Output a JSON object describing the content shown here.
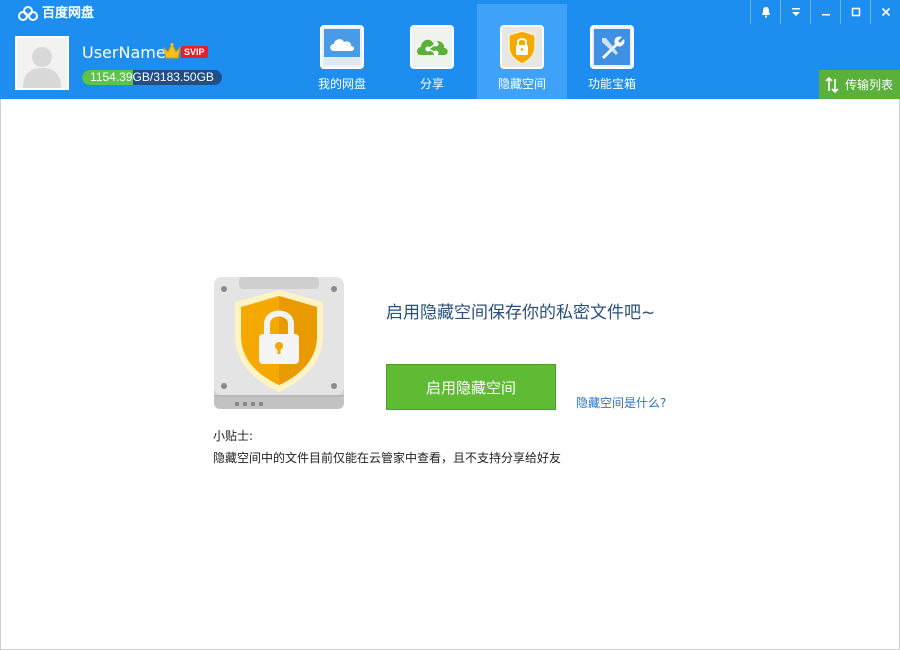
{
  "app": {
    "title": "百度网盘",
    "colors": {
      "header": "#1d8ef0",
      "active_tab": "#3ea3f8",
      "accent_green": "#5fba34",
      "link": "#2a74c8"
    }
  },
  "window_controls": {
    "icons": [
      "skin-icon",
      "dropdown-icon",
      "minimize-icon",
      "maximize-icon",
      "close-icon"
    ]
  },
  "user": {
    "name": "UserName",
    "vip_label": "SVIP",
    "quota_used": "1154.39",
    "quota_rest": "GB/3183.50GB",
    "quota_fraction": 0.363
  },
  "tabs": [
    {
      "label": "我的网盘",
      "icon": "cloud-icon",
      "active": false
    },
    {
      "label": "分享",
      "icon": "share-icon",
      "active": false
    },
    {
      "label": "隐藏空间",
      "icon": "lock-icon",
      "active": true
    },
    {
      "label": "功能宝箱",
      "icon": "tools-icon",
      "active": false
    }
  ],
  "transfer": {
    "label": "传输列表",
    "icon": "transfer-icon"
  },
  "hidden_space": {
    "promo": "启用隐藏空间保存你的私密文件吧~",
    "enable_button": "启用隐藏空间",
    "help_link": "隐藏空间是什么?",
    "tips_title": "小贴士:",
    "tips_text": "隐藏空间中的文件目前仅能在云管家中查看，且不支持分享给好友"
  }
}
